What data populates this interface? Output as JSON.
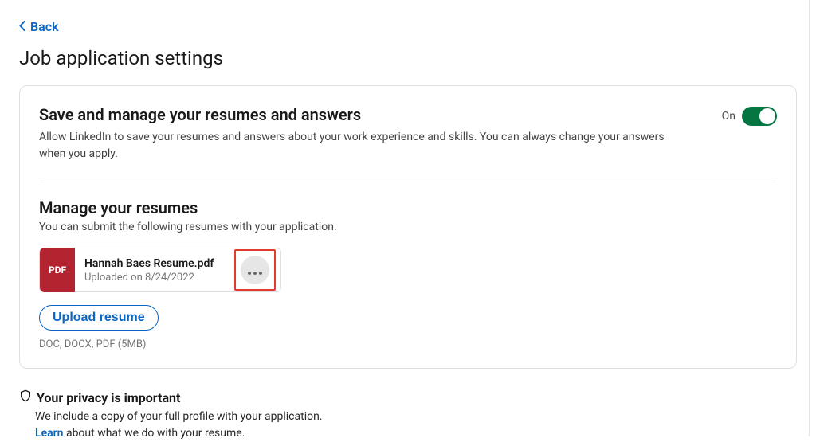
{
  "nav": {
    "back_label": "Back"
  },
  "page": {
    "title": "Job application settings"
  },
  "save_section": {
    "heading": "Save and manage your resumes and answers",
    "description": "Allow LinkedIn to save your resumes and answers about your work experience and skills. You can always change your answers when you apply.",
    "toggle_state_label": "On"
  },
  "resumes_section": {
    "heading": "Manage your resumes",
    "description": "You can submit the following resumes with your application.",
    "items": [
      {
        "badge": "PDF",
        "name": "Hannah Baes Resume.pdf",
        "uploaded": "Uploaded on 8/24/2022"
      }
    ],
    "upload_button": "Upload resume",
    "hint": "DOC, DOCX, PDF (5MB)"
  },
  "privacy": {
    "heading": "Your privacy is important",
    "line1": "We include a copy of your full profile with your application.",
    "learn_label": "Learn",
    "line2_rest": " about what we do with your resume."
  },
  "colors": {
    "accent": "#0a66c2",
    "toggle_on": "#057642",
    "pdf_badge": "#b32430",
    "highlight_border": "#e23a2f"
  }
}
